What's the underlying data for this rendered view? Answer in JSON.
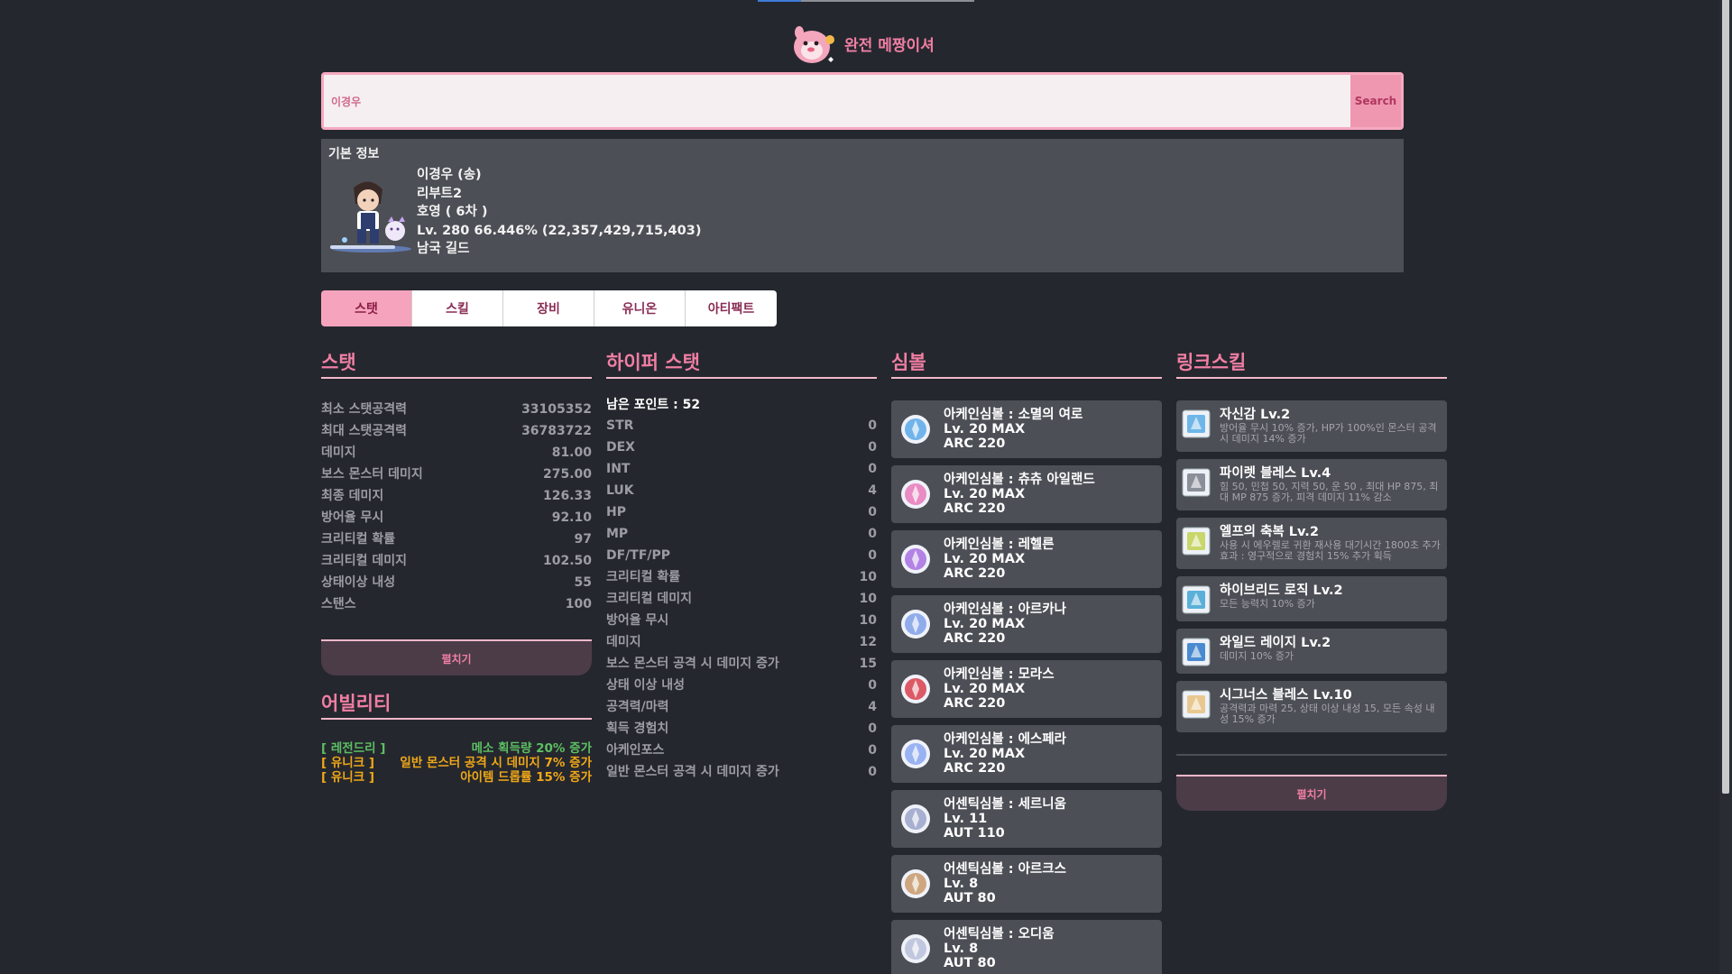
{
  "site": {
    "title": "완전 메짱이셔",
    "brand_color": "#f07fa3"
  },
  "search": {
    "value": "이경우",
    "button": "Search"
  },
  "profile": {
    "heading": "기본 정보",
    "name": "이경우 (송)",
    "world": "리부트2",
    "job": "호영 ( 6차 )",
    "level": "Lv. 280 66.446% (22,357,429,715,403)",
    "guild": "남국 길드"
  },
  "tabs": [
    "스탯",
    "스킬",
    "장비",
    "유니온",
    "아티팩트"
  ],
  "stats": {
    "title": "스탯",
    "rows": [
      {
        "label": "최소 스탯공격력",
        "value": "33105352"
      },
      {
        "label": "최대 스탯공격력",
        "value": "36783722"
      },
      {
        "label": "데미지",
        "value": "81.00"
      },
      {
        "label": "보스 몬스터 데미지",
        "value": "275.00"
      },
      {
        "label": "최종 데미지",
        "value": "126.33"
      },
      {
        "label": "방어율 무시",
        "value": "92.10"
      },
      {
        "label": "크리티컬 확률",
        "value": "97"
      },
      {
        "label": "크리티컬 데미지",
        "value": "102.50"
      },
      {
        "label": "상태이상 내성",
        "value": "55"
      },
      {
        "label": "스탠스",
        "value": "100"
      }
    ],
    "expand": "펼치기"
  },
  "ability": {
    "title": "어빌리티",
    "rows": [
      {
        "grade": "[ 레전드리 ]",
        "text": "메소 획득량 20% 증가",
        "color": "#5cc063"
      },
      {
        "grade": "[ 유니크 ]",
        "text": "일반 몬스터 공격 시 데미지 7% 증가",
        "color": "#f0a818"
      },
      {
        "grade": "[ 유니크 ]",
        "text": "아이템 드롭률 15% 증가",
        "color": "#f0a818"
      }
    ]
  },
  "hyper": {
    "title": "하이퍼 스탯",
    "points": "남은 포인트 : 52",
    "rows": [
      {
        "label": "STR",
        "value": "0"
      },
      {
        "label": "DEX",
        "value": "0"
      },
      {
        "label": "INT",
        "value": "0"
      },
      {
        "label": "LUK",
        "value": "4"
      },
      {
        "label": "HP",
        "value": "0"
      },
      {
        "label": "MP",
        "value": "0"
      },
      {
        "label": "DF/TF/PP",
        "value": "0"
      },
      {
        "label": "크리티컬 확률",
        "value": "10"
      },
      {
        "label": "크리티컬 데미지",
        "value": "10"
      },
      {
        "label": "방어율 무시",
        "value": "10"
      },
      {
        "label": "데미지",
        "value": "12"
      },
      {
        "label": "보스 몬스터 공격 시 데미지 증가",
        "value": "15"
      },
      {
        "label": "상태 이상 내성",
        "value": "0"
      },
      {
        "label": "공격력/마력",
        "value": "4"
      },
      {
        "label": "획득 경험치",
        "value": "0"
      },
      {
        "label": "아케인포스",
        "value": "0"
      },
      {
        "label": "일반 몬스터 공격 시 데미지 증가",
        "value": "0"
      }
    ]
  },
  "symbols": {
    "title": "심볼",
    "cards": [
      {
        "name": "아케인심볼 : 소멸의 여로",
        "level": "Lv. 20 MAX",
        "force": "ARC 220",
        "icon": "vanishing-journey-icon",
        "color": "#5aa9e8"
      },
      {
        "name": "아케인심볼 : 츄츄 아일랜드",
        "level": "Lv. 20 MAX",
        "force": "ARC 220",
        "icon": "chuchu-island-icon",
        "color": "#e87ab8"
      },
      {
        "name": "아케인심볼 : 레헬른",
        "level": "Lv. 20 MAX",
        "force": "ARC 220",
        "icon": "lachelein-icon",
        "color": "#a86fe0"
      },
      {
        "name": "아케인심볼 : 아르카나",
        "level": "Lv. 20 MAX",
        "force": "ARC 220",
        "icon": "arcana-icon",
        "color": "#7fa0e8"
      },
      {
        "name": "아케인심볼 : 모라스",
        "level": "Lv. 20 MAX",
        "force": "ARC 220",
        "icon": "morass-icon",
        "color": "#d8404a"
      },
      {
        "name": "아케인심볼 : 에스페라",
        "level": "Lv. 20 MAX",
        "force": "ARC 220",
        "icon": "esfera-icon",
        "color": "#8aa8f0"
      },
      {
        "name": "어센틱심볼 : 세르니움",
        "level": "Lv. 11",
        "force": "AUT 110",
        "icon": "cernium-icon",
        "color": "#9aa4c8"
      },
      {
        "name": "어센틱심볼 : 아르크스",
        "level": "Lv. 8",
        "force": "AUT 80",
        "icon": "arcus-icon",
        "color": "#c89a6a"
      },
      {
        "name": "어센틱심볼 : 오디움",
        "level": "Lv. 8",
        "force": "AUT 80",
        "icon": "odium-icon",
        "color": "#b8c0d8"
      }
    ]
  },
  "links": {
    "title": "링크스킬",
    "cards": [
      {
        "name": "자신감 Lv.2",
        "desc": "방어율 무시 10% 증가, HP가 100%인 몬스터 공격 시 데미지 14% 증가",
        "icon": "confidence-icon",
        "color": "#6fb6e8"
      },
      {
        "name": "파이렛 블레스 Lv.4",
        "desc": "힘 50, 민첩 50, 지력 50, 운 50 , 최대 HP 875, 최대 MP 875 증가, 피격 데미지 11% 감소",
        "icon": "pirate-blessing-icon",
        "color": "#8a8f9a"
      },
      {
        "name": "엘프의 축복 Lv.2",
        "desc": "사용 시 에우렐로 귀환 재사용 대기시간 1800초 추가효과 : 영구적으로 경험치 15% 추가 획득",
        "icon": "elven-blessing-icon",
        "color": "#c8d66a"
      },
      {
        "name": "하이브리드 로직 Lv.2",
        "desc": "모든 능력치 10% 증가",
        "icon": "hybrid-logic-icon",
        "color": "#5ab0d8"
      },
      {
        "name": "와일드 레이지 Lv.2",
        "desc": "데미지 10% 증가",
        "icon": "wild-rage-icon",
        "color": "#4a8ad0"
      },
      {
        "name": "시그너스 블레스 Lv.10",
        "desc": "공격력과 마력 25, 상태 이상 내성 15, 모든 속성 내성 15% 증가",
        "icon": "cygnus-blessing-icon",
        "color": "#e8c890"
      }
    ],
    "expand": "펼치기"
  }
}
